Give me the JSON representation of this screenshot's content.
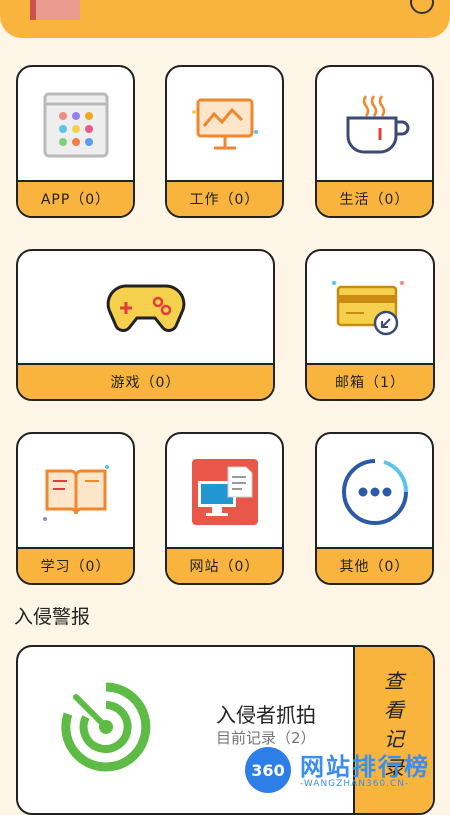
{
  "categories": {
    "app": "APP（0）",
    "work": "工作（0）",
    "life": "生活（0）",
    "game": "游戏（0）",
    "mail": "邮箱（1）",
    "study": "学习（0）",
    "website": "网站（0）",
    "other": "其他（0）"
  },
  "alert_section": {
    "title": "入侵警报",
    "card_title": "入侵者抓拍",
    "card_subtitle": "目前记录（2）",
    "view_chars": [
      "查",
      "看",
      "记",
      "录"
    ]
  },
  "watermark": {
    "badge": "360",
    "text": "网站排行榜",
    "domain": "-WANGZHAN360.CN-"
  }
}
